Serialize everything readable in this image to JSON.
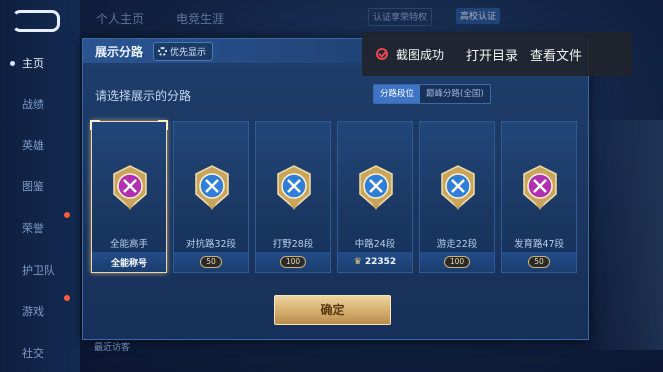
{
  "sidebar": {
    "items": [
      {
        "label": "主页"
      },
      {
        "label": "战绩"
      },
      {
        "label": "英雄"
      },
      {
        "label": "图鉴"
      },
      {
        "label": "荣誉"
      },
      {
        "label": "护卫队"
      },
      {
        "label": "游戏"
      },
      {
        "label": "社交"
      }
    ]
  },
  "top_tabs": [
    "个人主页",
    "电竞生涯"
  ],
  "top_right": {
    "verify_text": "认证享荣特权",
    "campus_badge": "高校认证"
  },
  "dialog": {
    "title": "展示分路",
    "priority_label": "优先显示",
    "subtitle": "请选择展示的分路",
    "toggle": {
      "options": [
        "分路段位",
        "巅峰分路(全国)"
      ],
      "selected_index": 0
    },
    "cards": [
      {
        "emblem": "all-round-emblem-icon",
        "label": "全能高手",
        "footer_type": "title",
        "footer": "全能称号",
        "color": "#b02fb2",
        "selected": true
      },
      {
        "emblem": "clash-lane-emblem-icon",
        "label": "对抗路32段",
        "footer_type": "points",
        "footer": "50",
        "color": "#2f7fd8",
        "selected": false
      },
      {
        "emblem": "jungle-emblem-icon",
        "label": "打野28段",
        "footer_type": "points",
        "footer": "100",
        "color": "#2f7fd8",
        "selected": false
      },
      {
        "emblem": "mid-lane-emblem-icon",
        "label": "中路24段",
        "footer_type": "rank",
        "footer": "22352",
        "color": "#2f7fd8",
        "selected": false
      },
      {
        "emblem": "roam-emblem-icon",
        "label": "游走22段",
        "footer_type": "points",
        "footer": "100",
        "color": "#2f7fd8",
        "selected": false
      },
      {
        "emblem": "farm-lane-emblem-icon",
        "label": "发育路47段",
        "footer_type": "points",
        "footer": "50",
        "color": "#b02fb2",
        "selected": false
      }
    ],
    "confirm_label": "确定"
  },
  "toast": {
    "message": "截图成功",
    "open_dir": "打开目录",
    "view_file": "查看文件"
  },
  "bottom": {
    "text": "最近访客"
  }
}
